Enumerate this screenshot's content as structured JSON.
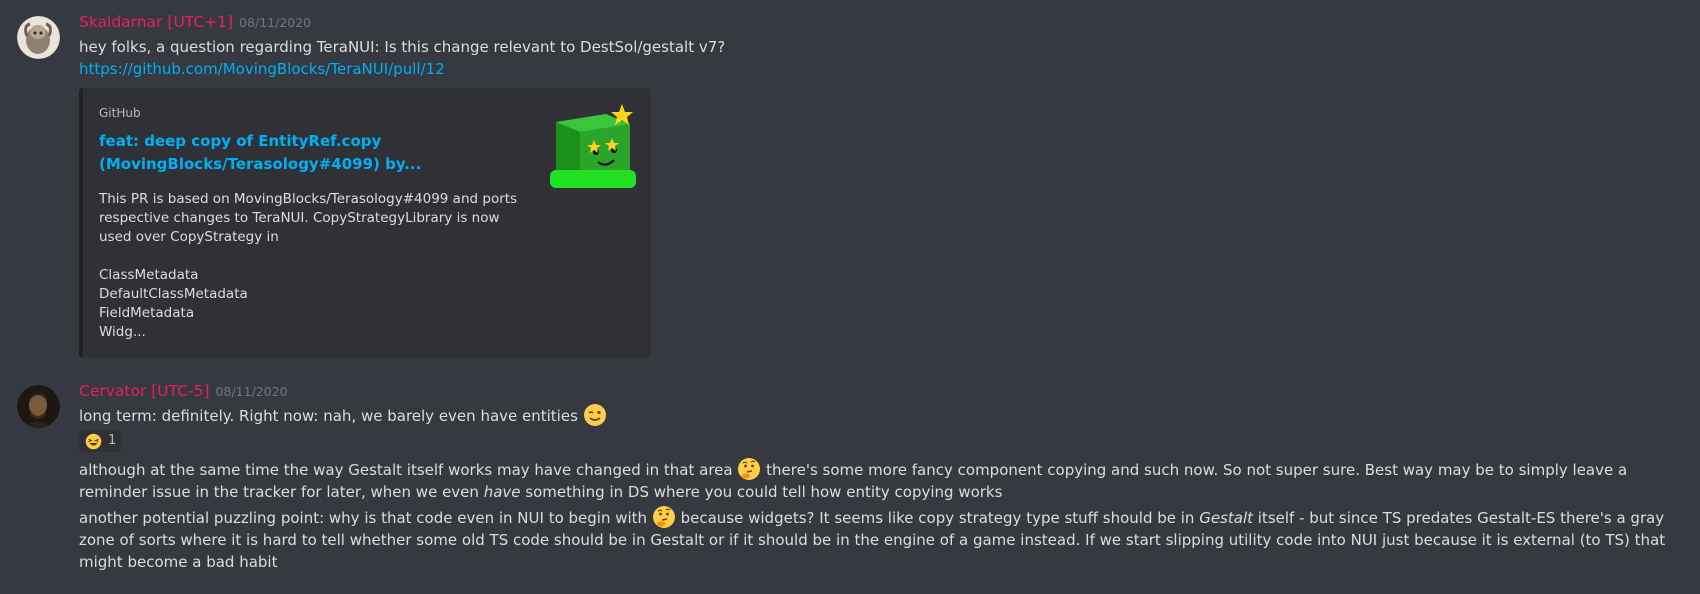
{
  "messages": [
    {
      "author": "Skaldarnar [UTC+1]",
      "timestamp": "08/11/2020",
      "text": "hey folks, a question regarding TeraNUI: Is this change relevant to DestSol/gestalt v7?",
      "link": "https://github.com/MovingBlocks/TeraNUI/pull/12",
      "embed": {
        "provider": "GitHub",
        "title": "feat: deep copy of EntityRef.copy (MovingBlocks/Terasology#4099) by...",
        "description": "This PR is based on MovingBlocks/Terasology#4099 and ports respective changes to TeraNUI. CopyStrategyLibrary is now used over CopyStrategy in\n\nClassMetadata\nDefaultClassMetadata\nFieldMetadata\nWidg..."
      }
    },
    {
      "author": "Cervator [UTC-5]",
      "timestamp": "08/11/2020",
      "text1": "long term: definitely. Right now: nah, we barely even have entities",
      "reaction_count": "1",
      "p2_a": "although at the same time the way Gestalt itself works may have changed in that area",
      "p2_b": " there's some more fancy component copying and such now. So not super sure. Best way may be to simply leave a reminder issue in the tracker for later, when we even ",
      "p2_em": "have",
      "p2_c": " something in DS where you could tell how entity copying works",
      "p3_a": "another potential puzzling point: why is that code even in NUI to begin with",
      "p3_b": " because widgets? It seems like copy strategy type stuff should be in ",
      "p3_em": "Gestalt",
      "p3_c": " itself - but since TS predates Gestalt-ES there's a gray zone of sorts where it is hard to tell whether some old TS code should be in Gestalt or if it should be in the engine of a game instead. If we start slipping utility code into NUI just because it is external (to TS) that might become a bad habit"
    }
  ],
  "icons": {
    "wink": "wink-emoji",
    "laugh": "laughing-emoji",
    "thinking": "thinking-emoji"
  },
  "colors": {
    "background": "#36393f",
    "author": "#e91e63",
    "link": "#00b0f4",
    "embed_bg": "#2f3136"
  }
}
